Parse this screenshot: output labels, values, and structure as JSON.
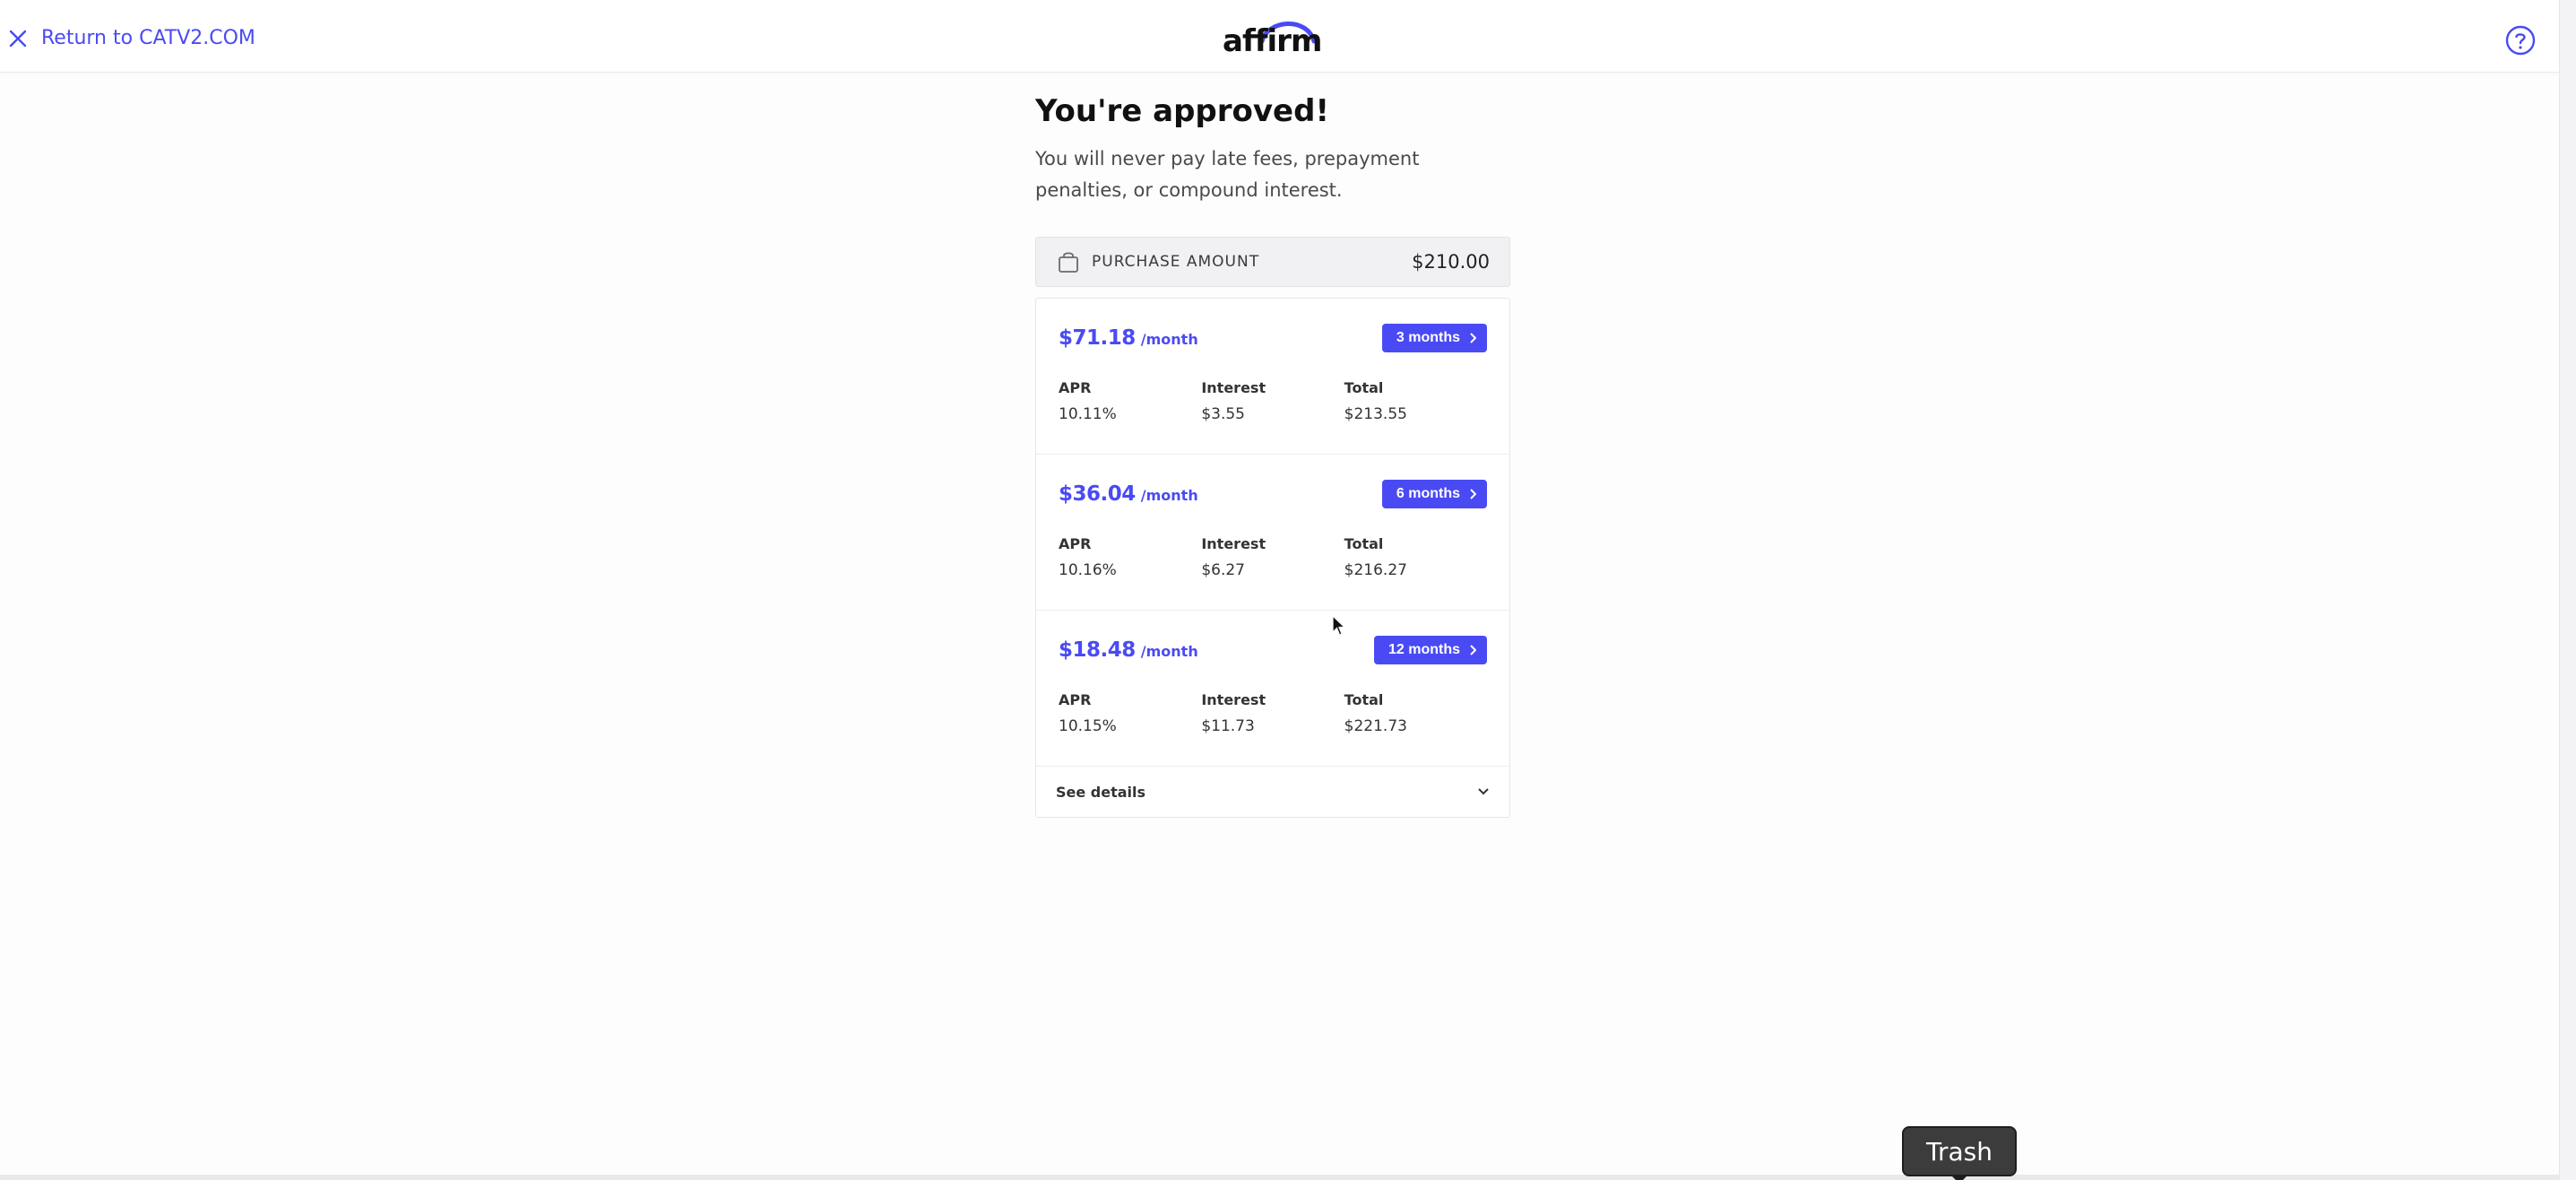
{
  "header": {
    "return_label": "Return to CATV2.COM",
    "logo_text": "affirm",
    "help_icon": "question-circle-icon"
  },
  "main": {
    "title": "You're approved!",
    "subtitle": "You will never pay late fees, prepayment penalties, or compound interest.",
    "purchase": {
      "label": "PURCHASE AMOUNT",
      "amount": "$210.00"
    },
    "plans": [
      {
        "price": "$71.18",
        "per": "/month",
        "term": "3 months",
        "apr_label": "APR",
        "apr": "10.11%",
        "interest_label": "Interest",
        "interest": "$3.55",
        "total_label": "Total",
        "total": "$213.55"
      },
      {
        "price": "$36.04",
        "per": "/month",
        "term": "6 months",
        "apr_label": "APR",
        "apr": "10.16%",
        "interest_label": "Interest",
        "interest": "$6.27",
        "total_label": "Total",
        "total": "$216.27"
      },
      {
        "price": "$18.48",
        "per": "/month",
        "term": "12 months",
        "apr_label": "APR",
        "apr": "10.15%",
        "interest_label": "Interest",
        "interest": "$11.73",
        "total_label": "Total",
        "total": "$221.73"
      }
    ],
    "see_details": "See details"
  },
  "dock": {
    "tooltip": "Trash"
  },
  "colors": {
    "accent": "#4a4af4",
    "background": "#fdfdfe",
    "purchase_bar": "#f1f1f3"
  }
}
